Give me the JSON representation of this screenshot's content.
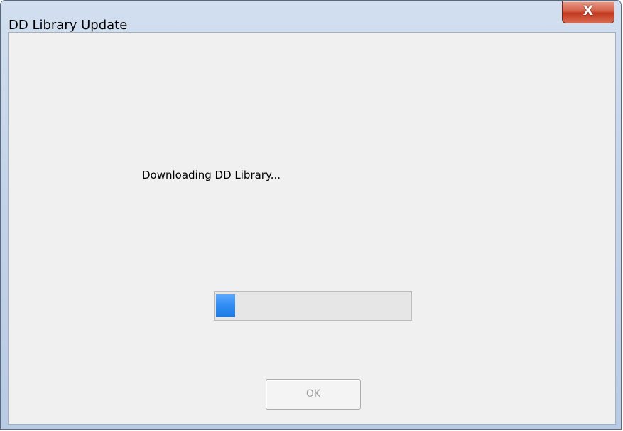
{
  "window": {
    "title": "DD Library Update",
    "close_glyph": "X",
    "close_icon": "close-icon"
  },
  "content": {
    "message": "Downloading DD Library...",
    "progress": 0.1,
    "progress_color": "#2f8cf2"
  },
  "buttons": {
    "ok_label": "OK",
    "ok_enabled": false
  }
}
